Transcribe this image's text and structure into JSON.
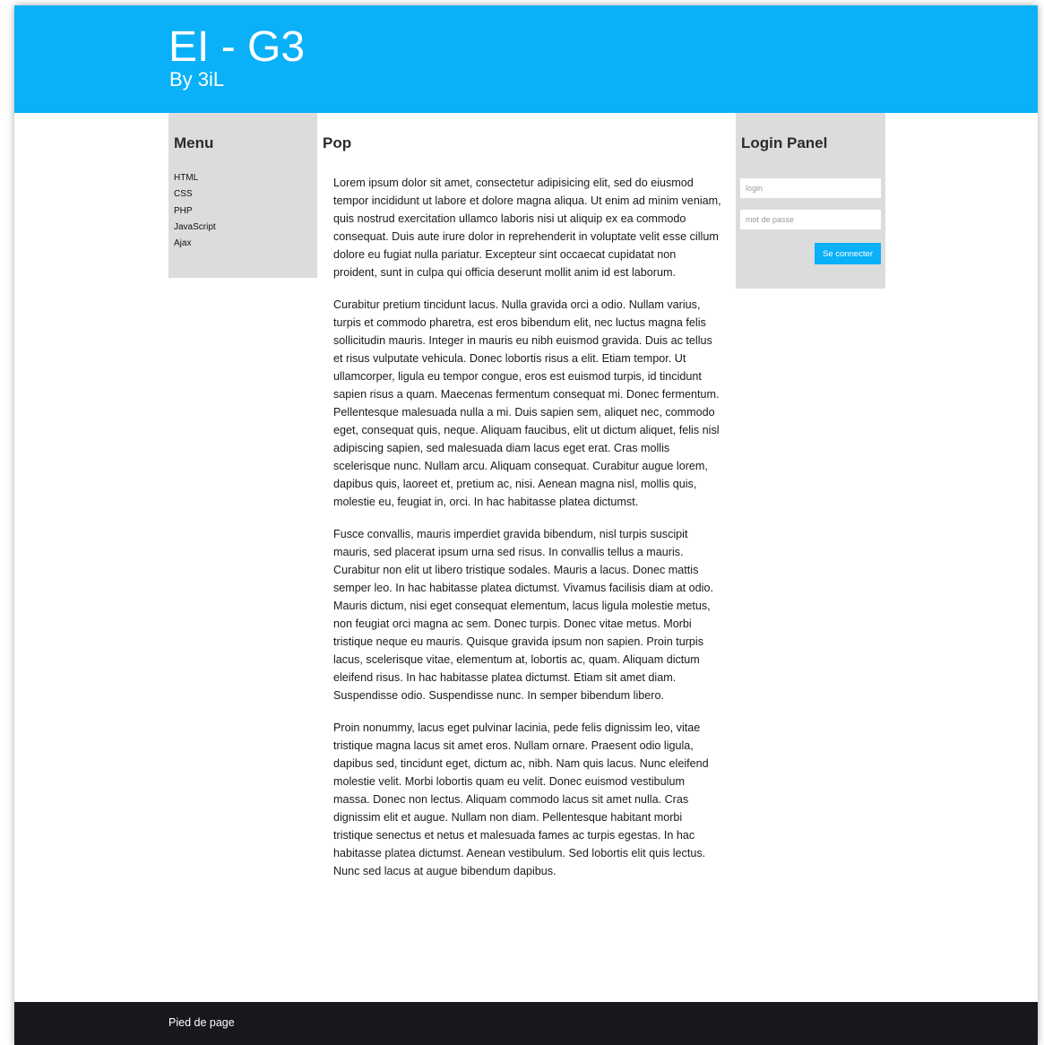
{
  "header": {
    "title": "EI - G3",
    "subtitle": "By 3iL"
  },
  "menu": {
    "heading": "Menu",
    "items": [
      "HTML",
      "CSS",
      "PHP",
      "JavaScript",
      "Ajax"
    ]
  },
  "content": {
    "title": "Pop",
    "paragraphs": [
      "Lorem ipsum dolor sit amet, consectetur adipisicing elit, sed do eiusmod tempor incididunt ut labore et dolore magna aliqua. Ut enim ad minim veniam, quis nostrud exercitation ullamco laboris nisi ut aliquip ex ea commodo consequat. Duis aute irure dolor in reprehenderit in voluptate velit esse cillum dolore eu fugiat nulla pariatur. Excepteur sint occaecat cupidatat non proident, sunt in culpa qui officia deserunt mollit anim id est laborum.",
      "Curabitur pretium tincidunt lacus. Nulla gravida orci a odio. Nullam varius, turpis et commodo pharetra, est eros bibendum elit, nec luctus magna felis sollicitudin mauris. Integer in mauris eu nibh euismod gravida. Duis ac tellus et risus vulputate vehicula. Donec lobortis risus a elit. Etiam tempor. Ut ullamcorper, ligula eu tempor congue, eros est euismod turpis, id tincidunt sapien risus a quam. Maecenas fermentum consequat mi. Donec fermentum. Pellentesque malesuada nulla a mi. Duis sapien sem, aliquet nec, commodo eget, consequat quis, neque. Aliquam faucibus, elit ut dictum aliquet, felis nisl adipiscing sapien, sed malesuada diam lacus eget erat. Cras mollis scelerisque nunc. Nullam arcu. Aliquam consequat. Curabitur augue lorem, dapibus quis, laoreet et, pretium ac, nisi. Aenean magna nisl, mollis quis, molestie eu, feugiat in, orci. In hac habitasse platea dictumst.",
      "Fusce convallis, mauris imperdiet gravida bibendum, nisl turpis suscipit mauris, sed placerat ipsum urna sed risus. In convallis tellus a mauris. Curabitur non elit ut libero tristique sodales. Mauris a lacus. Donec mattis semper leo. In hac habitasse platea dictumst. Vivamus facilisis diam at odio. Mauris dictum, nisi eget consequat elementum, lacus ligula molestie metus, non feugiat orci magna ac sem. Donec turpis. Donec vitae metus. Morbi tristique neque eu mauris. Quisque gravida ipsum non sapien. Proin turpis lacus, scelerisque vitae, elementum at, lobortis ac, quam. Aliquam dictum eleifend risus. In hac habitasse platea dictumst. Etiam sit amet diam. Suspendisse odio. Suspendisse nunc. In semper bibendum libero.",
      "Proin nonummy, lacus eget pulvinar lacinia, pede felis dignissim leo, vitae tristique magna lacus sit amet eros. Nullam ornare. Praesent odio ligula, dapibus sed, tincidunt eget, dictum ac, nibh. Nam quis lacus. Nunc eleifend molestie velit. Morbi lobortis quam eu velit. Donec euismod vestibulum massa. Donec non lectus. Aliquam commodo lacus sit amet nulla. Cras dignissim elit et augue. Nullam non diam. Pellentesque habitant morbi tristique senectus et netus et malesuada fames ac turpis egestas. In hac habitasse platea dictumst. Aenean vestibulum. Sed lobortis elit quis lectus. Nunc sed lacus at augue bibendum dapibus."
    ]
  },
  "login": {
    "heading": "Login Panel",
    "login_placeholder": "login",
    "password_placeholder": "mot de passe",
    "submit_label": "Se connecter"
  },
  "footer": {
    "text": "Pied de page"
  },
  "colors": {
    "header_bg": "#0ab0f8",
    "sidebar_bg": "#dcdcdc",
    "footer_bg": "#16181d",
    "button_bg": "#0ab0f8"
  }
}
